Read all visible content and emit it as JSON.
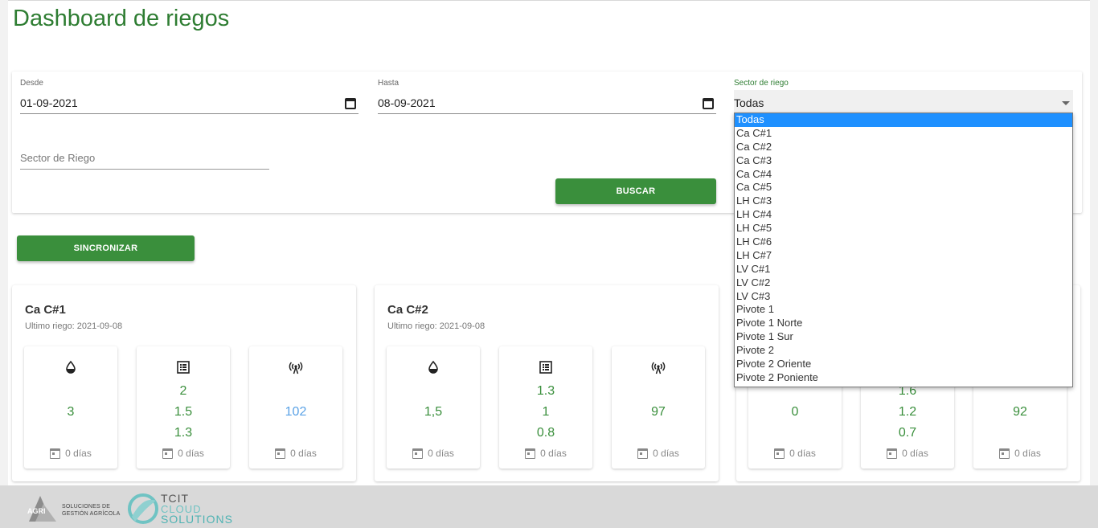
{
  "page": {
    "title": "Dashboard de riegos"
  },
  "filters": {
    "desde": {
      "label": "Desde",
      "value": "01-09-2021"
    },
    "hasta": {
      "label": "Hasta",
      "value": "08-09-2021"
    },
    "sector": {
      "label": "Sector de riego",
      "value": "Todas"
    },
    "sector_search": {
      "placeholder": "Sector de Riego"
    },
    "buscar_label": "BUSCAR"
  },
  "sync_label": "SINCRONIZAR",
  "dropdown": {
    "options": [
      "Todas",
      "Ca C#1",
      "Ca C#2",
      "Ca C#3",
      "Ca C#4",
      "Ca C#5",
      "LH C#3",
      "LH C#4",
      "LH C#5",
      "LH C#6",
      "LH C#7",
      "LV C#1",
      "LV C#2",
      "LV C#3",
      "Pivote 1",
      "Pivote 1 Norte",
      "Pivote 1 Sur",
      "Pivote 2",
      "Pivote 2 Oriente",
      "Pivote 2 Poniente"
    ],
    "selected": "Todas"
  },
  "sectors": [
    {
      "name": "Ca C#1",
      "last": "Ultimo riego: 2021-09-08",
      "metrics": [
        {
          "icon": "water-drop-icon",
          "values": [
            "3"
          ],
          "foot": "0 días"
        },
        {
          "icon": "list-icon",
          "values": [
            "2",
            "1.5",
            "1.3"
          ],
          "foot": "0 días"
        },
        {
          "icon": "antenna-icon",
          "values": [
            "102"
          ],
          "foot": "0 días",
          "color": "blue"
        }
      ]
    },
    {
      "name": "Ca C#2",
      "last": "Ultimo riego: 2021-09-08",
      "metrics": [
        {
          "icon": "water-drop-icon",
          "values": [
            "1,5"
          ],
          "foot": "0 días"
        },
        {
          "icon": "list-icon",
          "values": [
            "1.3",
            "1",
            "0.8"
          ],
          "foot": "0 días"
        },
        {
          "icon": "antenna-icon",
          "values": [
            "97"
          ],
          "foot": "0 días"
        }
      ]
    },
    {
      "name": "",
      "last": "",
      "metrics": [
        {
          "icon": "water-drop-icon",
          "values": [
            "0"
          ],
          "foot": "0 días"
        },
        {
          "icon": "list-icon",
          "values": [
            "1.6",
            "1.2",
            "0.7"
          ],
          "foot": "0 días"
        },
        {
          "icon": "antenna-icon",
          "values": [
            "92"
          ],
          "foot": "0 días"
        }
      ]
    }
  ],
  "colors": {
    "accent": "#3a8f3c",
    "title": "#2e7d32",
    "selection": "#1e90ff",
    "value_blue": "#5aa2e6"
  },
  "footer": {
    "agri_text_1": "SOLUCIONES DE",
    "agri_text_2": "GESTIÓN AGRÍCOLA",
    "agri_badge": "AGRI",
    "tcit_1": "TCIT",
    "tcit_2": "CLOUD",
    "tcit_3": "SOLUTIONS"
  }
}
